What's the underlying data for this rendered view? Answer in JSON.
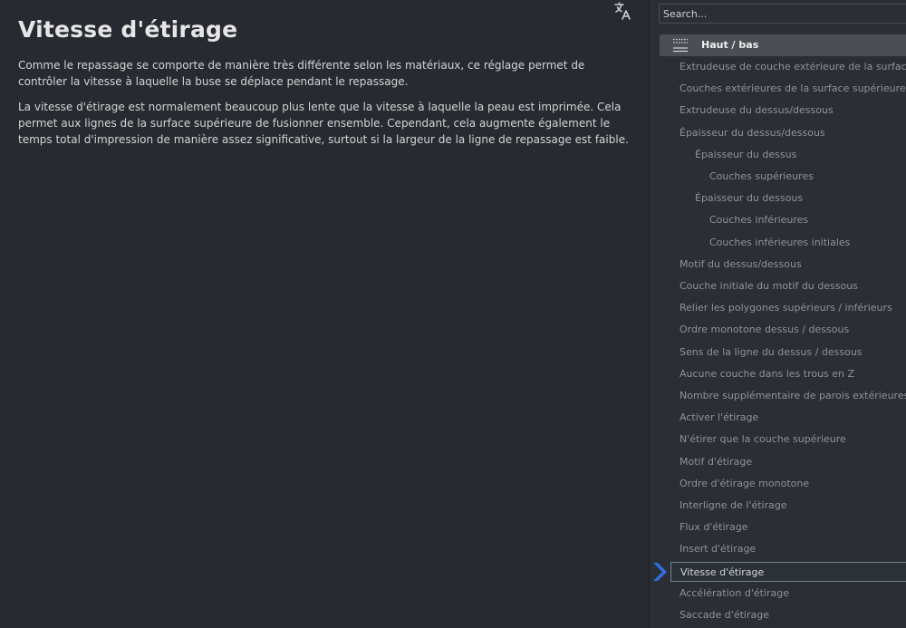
{
  "description": {
    "title": "Vitesse d'étirage",
    "paragraphs": [
      "Comme le repassage se comporte de manière très différente selon les matériaux, ce réglage permet de contrôler la vitesse à laquelle la buse se déplace pendant le repassage.",
      "La vitesse d'étirage est normalement beaucoup plus lente que la vitesse à laquelle la peau est imprimée. Cela permet aux lignes de la surface supérieure de fusionner ensemble. Cependant, cela augmente également le temps total d'impression de manière assez significative, surtout si la largeur de la ligne de repassage est faible."
    ],
    "translate_icon": "translate-icon"
  },
  "settings": {
    "search": {
      "placeholder": "Search...",
      "value": ""
    },
    "category": {
      "label": "Haut / bas",
      "icon": "top-bottom-icon"
    },
    "items": [
      {
        "label": "Extrudeuse de couche extérieure de la surface supérieure",
        "level": 0,
        "selected": false
      },
      {
        "label": "Couches extérieures de la surface supérieure",
        "level": 0,
        "selected": false
      },
      {
        "label": "Extrudeuse du dessus/dessous",
        "level": 0,
        "selected": false
      },
      {
        "label": "Épaisseur du dessus/dessous",
        "level": 0,
        "selected": false
      },
      {
        "label": "Épaisseur du dessus",
        "level": 1,
        "selected": false
      },
      {
        "label": "Couches supérieures",
        "level": 2,
        "selected": false
      },
      {
        "label": "Épaisseur du dessous",
        "level": 1,
        "selected": false
      },
      {
        "label": "Couches inférieures",
        "level": 2,
        "selected": false
      },
      {
        "label": "Couches inférieures initiales",
        "level": 2,
        "selected": false
      },
      {
        "label": "Motif du dessus/dessous",
        "level": 0,
        "selected": false
      },
      {
        "label": "Couche initiale du motif du dessous",
        "level": 0,
        "selected": false
      },
      {
        "label": "Relier les polygones supérieurs / inférieurs",
        "level": 0,
        "selected": false
      },
      {
        "label": "Ordre monotone dessus / dessous",
        "level": 0,
        "selected": false
      },
      {
        "label": "Sens de la ligne du dessus / dessous",
        "level": 0,
        "selected": false
      },
      {
        "label": "Aucune couche dans les trous en Z",
        "level": 0,
        "selected": false
      },
      {
        "label": "Nombre supplémentaire de parois extérieures",
        "level": 0,
        "selected": false
      },
      {
        "label": "Activer l'étirage",
        "level": 0,
        "selected": false
      },
      {
        "label": "N'étirer que la couche supérieure",
        "level": 0,
        "selected": false
      },
      {
        "label": "Motif d'étirage",
        "level": 0,
        "selected": false
      },
      {
        "label": "Ordre d'étirage monotone",
        "level": 0,
        "selected": false
      },
      {
        "label": "Interligne de l'étirage",
        "level": 0,
        "selected": false
      },
      {
        "label": "Flux d'étirage",
        "level": 0,
        "selected": false
      },
      {
        "label": "Insert d'étirage",
        "level": 0,
        "selected": false
      },
      {
        "label": "Vitesse d'étirage",
        "level": 0,
        "selected": true
      },
      {
        "label": "Accélération d'étirage",
        "level": 0,
        "selected": false
      },
      {
        "label": "Saccade d'étirage",
        "level": 0,
        "selected": false
      }
    ],
    "pointer_icon": "chevron-right-icon",
    "colors": {
      "accent_arrow": "#2f6ee0",
      "selected_border": "#6a8791",
      "item_text": "#8e939b",
      "category_bg": "#4b4e55"
    }
  }
}
